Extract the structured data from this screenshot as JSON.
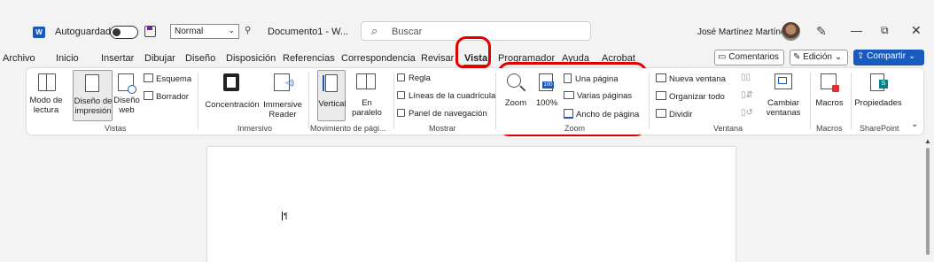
{
  "titlebar": {
    "autosave_label": "Autoguardado",
    "style_value": "Normal",
    "doc_name": "Documento1 - W...",
    "search_placeholder": "Buscar",
    "user_name": "José Martínez Martínez"
  },
  "tabs": [
    "Archivo",
    "Inicio",
    "Insertar",
    "Dibujar",
    "Diseño",
    "Disposición",
    "Referencias",
    "Correspondencia",
    "Revisar",
    "Vista",
    "Programador",
    "Ayuda",
    "Acrobat"
  ],
  "active_tab": "Vista",
  "top_right": {
    "comments": "Comentarios",
    "editing": "Edición",
    "share": "Compartir"
  },
  "ribbon": {
    "vistas": {
      "label": "Vistas",
      "modo_lectura": [
        "Modo de",
        "lectura"
      ],
      "diseno_impresion": [
        "Diseño de",
        "impresión"
      ],
      "diseno_web": [
        "Diseño",
        "web"
      ],
      "esquema": "Esquema",
      "borrador": "Borrador"
    },
    "inmersivo": {
      "label": "Inmersivo",
      "concentracion": "Concentración",
      "immersive_reader": [
        "Immersive",
        "Reader"
      ]
    },
    "movimiento": {
      "label": "Movimiento de pági...",
      "vertical": "Vertical",
      "en_paralelo": [
        "En",
        "paralelo"
      ]
    },
    "mostrar": {
      "label": "Mostrar",
      "regla": "Regla",
      "lineas": "Líneas de la cuadrícula",
      "panel": "Panel de navegación"
    },
    "zoom": {
      "label": "Zoom",
      "zoom": "Zoom",
      "pct": "100%",
      "una_pagina": "Una página",
      "varias_paginas": "Varias páginas",
      "ancho_pagina": "Ancho de página"
    },
    "ventana": {
      "label": "Ventana",
      "nueva_ventana": "Nueva ventana",
      "organizar": "Organizar todo",
      "dividir": "Dividir",
      "cambiar": [
        "Cambiar",
        "ventanas"
      ]
    },
    "macros": {
      "label": "Macros",
      "macros": "Macros"
    },
    "sharepoint": {
      "label": "SharePoint",
      "propiedades": "Propiedades"
    }
  },
  "colors": {
    "accent": "#185abd",
    "annotation": "#e00000"
  }
}
